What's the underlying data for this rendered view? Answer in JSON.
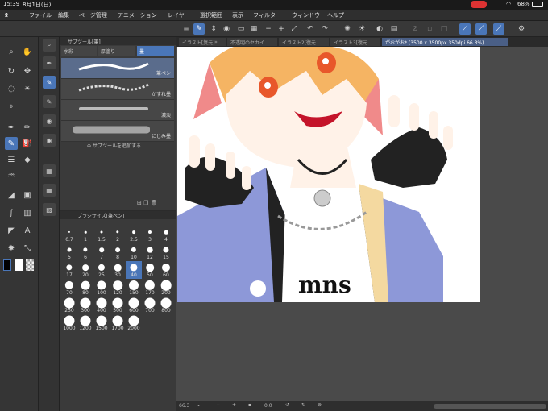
{
  "status": {
    "time": "15:39",
    "date": "8月1日(日)",
    "battery": "68%"
  },
  "menu": {
    "items": [
      "ファイル",
      "編集",
      "ページ管理",
      "アニメーション",
      "レイヤー",
      "選択範囲",
      "表示",
      "フィルター",
      "ウィンドウ",
      "ヘルプ"
    ]
  },
  "tabs": [
    {
      "label": "イラスト[复元]*"
    },
    {
      "label": "不透明のセカイ"
    },
    {
      "label": "イラスト2[復元"
    },
    {
      "label": "イラスト3[復元"
    },
    {
      "label": "がおがお* (3500 x 3500px 350dpi 66.3%)"
    }
  ],
  "subtool": {
    "title": "サブツール[筆]",
    "tabs": [
      "水彩",
      "厚塗り",
      "墨"
    ],
    "brushes": [
      {
        "label": "筆ペン"
      },
      {
        "label": "かすれ墨"
      },
      {
        "label": "濃淡"
      },
      {
        "label": "にじみ墨"
      }
    ],
    "add_label": "サブツールを追加する"
  },
  "brushsize": {
    "title": "ブラシサイズ[筆ペン]",
    "sizes": [
      "0.7",
      "1",
      "1.5",
      "2",
      "2.5",
      "3",
      "4",
      "5",
      "6",
      "7",
      "8",
      "10",
      "12",
      "15",
      "17",
      "20",
      "25",
      "30",
      "40",
      "50",
      "60",
      "70",
      "80",
      "100",
      "120",
      "150",
      "170",
      "200",
      "250",
      "300",
      "400",
      "500",
      "600",
      "700",
      "800",
      "1000",
      "1200",
      "1500",
      "1700",
      "2000"
    ],
    "selected": "40"
  },
  "bottom": {
    "zoom": "66.3",
    "angle": "0.0"
  },
  "colors": {
    "accent": "#4a76b8",
    "panel": "#3a3a3a",
    "artwork_bg": "#ffffff"
  }
}
